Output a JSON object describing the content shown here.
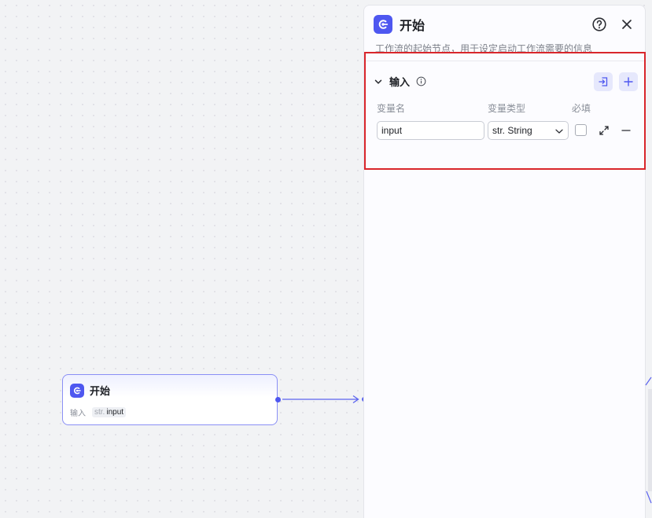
{
  "canvas": {
    "node": {
      "title": "开始",
      "input_label": "输入",
      "var_type": "str.",
      "var_name": "input"
    }
  },
  "panel": {
    "title": "开始",
    "description": "工作流的起始节点，用于设定启动工作流需要的信息",
    "section": {
      "title": "输入",
      "columns": {
        "name": "变量名",
        "type": "变量类型",
        "required": "必填"
      },
      "variables": [
        {
          "name": "input",
          "type": "str. String",
          "required": false
        }
      ]
    }
  },
  "colors": {
    "accent": "#4e57f0",
    "highlight": "#d9262b"
  },
  "icons": [
    "start-logo-icon",
    "help-icon",
    "close-icon",
    "chevron-down-icon",
    "info-icon",
    "import-icon",
    "plus-icon",
    "expand-icon",
    "minus-icon"
  ]
}
